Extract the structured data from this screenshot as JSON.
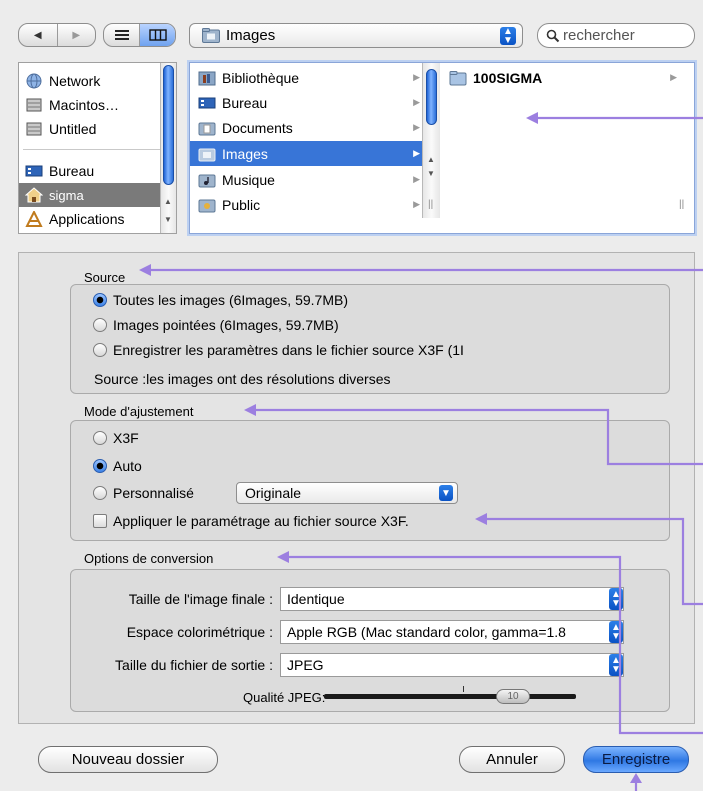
{
  "toolbar": {
    "back_label": "◀",
    "forward_label": "▶",
    "location": "Images",
    "search_placeholder": "rechercher"
  },
  "sidebar": {
    "items": [
      {
        "label": "Network",
        "icon": "network-icon"
      },
      {
        "label": "Macintos…",
        "icon": "hard-disk-icon"
      },
      {
        "label": "Untitled",
        "icon": "hard-disk-icon"
      },
      {
        "label": "Bureau",
        "icon": "desktop-icon"
      },
      {
        "label": "sigma",
        "icon": "home-icon"
      },
      {
        "label": "Applications",
        "icon": "applications-icon"
      }
    ]
  },
  "browser": {
    "column1": [
      {
        "label": "Bibliothèque"
      },
      {
        "label": "Bureau"
      },
      {
        "label": "Documents"
      },
      {
        "label": "Images"
      },
      {
        "label": "Musique"
      },
      {
        "label": "Public"
      }
    ],
    "column2": [
      {
        "label": "100SIGMA"
      }
    ]
  },
  "source": {
    "title": "Source",
    "options": [
      "Toutes les images (6Images, 59.7MB)",
      "Images pointées (6Images, 59.7MB)",
      "Enregistrer les paramètres dans le fichier source  X3F (1I"
    ],
    "note": "Source :les images ont des résolutions diverses"
  },
  "adjust": {
    "title": "Mode d'ajustement",
    "options": [
      "X3F",
      "Auto",
      "Personnalisé"
    ],
    "custom_value": "Originale",
    "apply_label": "Appliquer le paramétrage au fichier source X3F."
  },
  "conversion": {
    "title": "Options de conversion",
    "size_label": "Taille de l'image finale :",
    "size_value": "Identique",
    "color_label": "Espace colorimétrique :",
    "color_value": "Apple RGB (Mac standard color, gamma=1.8",
    "file_label": "Taille du fichier de sortie :",
    "file_value": "JPEG",
    "quality_label": "Qualité JPEG:",
    "quality_value": "10"
  },
  "buttons": {
    "new_folder": "Nouveau dossier",
    "cancel": "Annuler",
    "save": "Enregistre"
  },
  "colors": {
    "accent": "#3875d7",
    "annotation": "#9c7fe0"
  }
}
